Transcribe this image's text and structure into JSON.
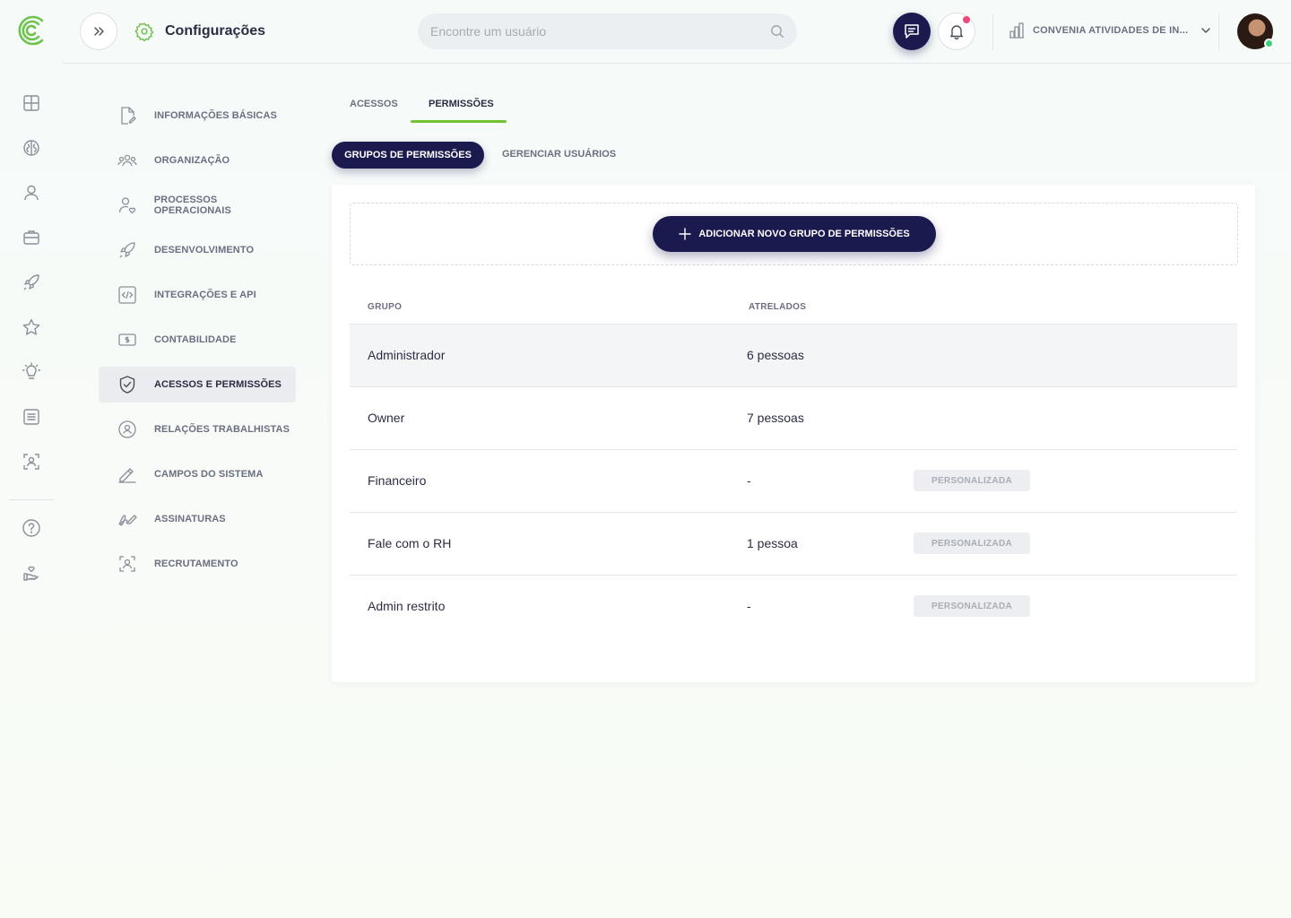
{
  "header": {
    "title": "Configurações",
    "search_placeholder": "Encontre um usuário",
    "company": "CONVENIA ATIVIDADES DE IN..."
  },
  "settings_menu": {
    "items": [
      {
        "label": "INFORMAÇÕES BÁSICAS",
        "icon": "document-edit-icon"
      },
      {
        "label": "ORGANIZAÇÃO",
        "icon": "people-group-icon"
      },
      {
        "label": "PROCESSOS OPERACIONAIS",
        "icon": "person-heart-icon"
      },
      {
        "label": "DESENVOLVIMENTO",
        "icon": "rocket-icon"
      },
      {
        "label": "INTEGRAÇÕES E API",
        "icon": "code-icon"
      },
      {
        "label": "CONTABILIDADE",
        "icon": "money-bill-icon"
      },
      {
        "label": "ACESSOS E PERMISSÕES",
        "icon": "shield-check-icon",
        "active": true
      },
      {
        "label": "RELAÇÕES TRABALHISTAS",
        "icon": "person-circle-icon"
      },
      {
        "label": "CAMPOS DO SISTEMA",
        "icon": "pencil-icon"
      },
      {
        "label": "ASSINATURAS",
        "icon": "signature-icon"
      },
      {
        "label": "RECRUTAMENTO",
        "icon": "recruit-scan-icon"
      }
    ]
  },
  "tabs": {
    "acessos": "ACESSOS",
    "permissoes": "PERMISSÕES"
  },
  "subtabs": {
    "grupos": "GRUPOS DE PERMISSÕES",
    "gerenciar": "GERENCIAR USUÁRIOS"
  },
  "add_button": "ADICIONAR NOVO GRUPO DE PERMISSÕES",
  "table": {
    "headers": {
      "group": "GRUPO",
      "attached": "ATRELADOS"
    },
    "rows": [
      {
        "group": "Administrador",
        "attached": "6 pessoas",
        "badge": ""
      },
      {
        "group": "Owner",
        "attached": "7 pessoas",
        "badge": ""
      },
      {
        "group": "Financeiro",
        "attached": "-",
        "badge": "PERSONALIZADA"
      },
      {
        "group": "Fale com o RH",
        "attached": "1 pessoa",
        "badge": "PERSONALIZADA"
      },
      {
        "group": "Admin restrito",
        "attached": "-",
        "badge": "PERSONALIZADA"
      }
    ]
  },
  "colors": {
    "primary": "#1b1a4f",
    "accent_green": "#72c334",
    "notification": "#f0467a",
    "online": "#3ecf7a"
  }
}
